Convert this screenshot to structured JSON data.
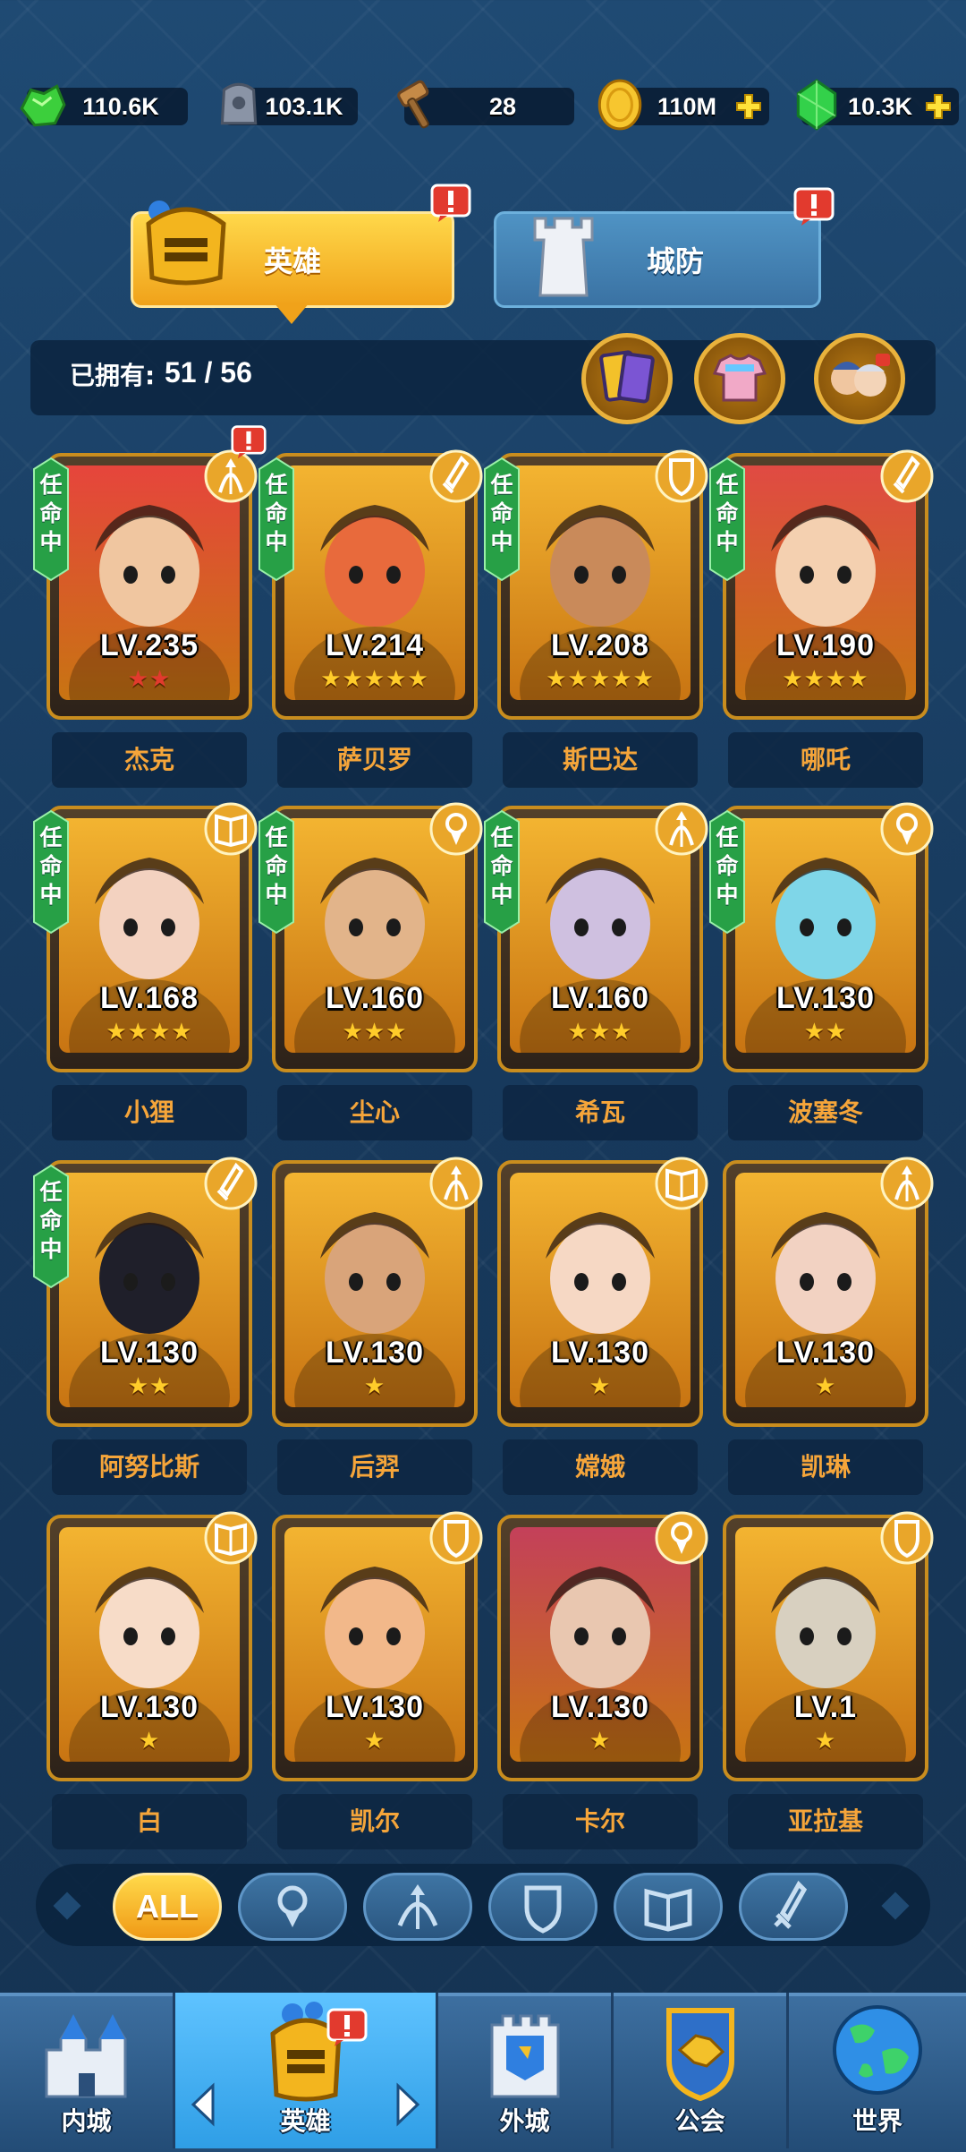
{
  "resources": [
    {
      "name": "energy",
      "value": "110.6K",
      "icon": "green-gem-cluster-icon",
      "has_plus": false
    },
    {
      "name": "stone",
      "value": "103.1K",
      "icon": "stone-tablet-icon",
      "has_plus": false
    },
    {
      "name": "hammer",
      "value": "28",
      "icon": "hammer-icon",
      "has_plus": false
    },
    {
      "name": "gold",
      "value": "110M",
      "icon": "gold-coin-icon",
      "has_plus": true
    },
    {
      "name": "gems",
      "value": "10.3K",
      "icon": "green-gem-icon",
      "has_plus": true
    }
  ],
  "tabs": {
    "heroes": "英雄",
    "defense": "城防",
    "active": "heroes"
  },
  "owned": {
    "label": "已拥有:",
    "count": "51 / 56"
  },
  "heroes": [
    {
      "name": "杰克",
      "level": "LV.235",
      "stars": 2,
      "star_color": "red",
      "class": "archer",
      "appointed": true,
      "alert": true
    },
    {
      "name": "萨贝罗",
      "level": "LV.214",
      "stars": 5,
      "star_color": "gold",
      "class": "warrior",
      "appointed": true,
      "alert": false
    },
    {
      "name": "斯巴达",
      "level": "LV.208",
      "stars": 5,
      "star_color": "gold",
      "class": "tank",
      "appointed": true,
      "alert": false
    },
    {
      "name": "哪吒",
      "level": "LV.190",
      "stars": 4,
      "star_color": "gold",
      "class": "warrior",
      "appointed": true,
      "alert": false
    },
    {
      "name": "小狸",
      "level": "LV.168",
      "stars": 4,
      "star_color": "gold",
      "class": "mage",
      "appointed": true,
      "alert": false
    },
    {
      "name": "尘心",
      "level": "LV.160",
      "stars": 3,
      "star_color": "gold",
      "class": "support",
      "appointed": true,
      "alert": false
    },
    {
      "name": "希瓦",
      "level": "LV.160",
      "stars": 3,
      "star_color": "gold",
      "class": "archer",
      "appointed": true,
      "alert": false
    },
    {
      "name": "波塞冬",
      "level": "LV.130",
      "stars": 2,
      "star_color": "gold",
      "class": "support",
      "appointed": true,
      "alert": false
    },
    {
      "name": "阿努比斯",
      "level": "LV.130",
      "stars": 2,
      "star_color": "gold",
      "class": "warrior",
      "appointed": true,
      "alert": false
    },
    {
      "name": "后羿",
      "level": "LV.130",
      "stars": 1,
      "star_color": "gold",
      "class": "archer",
      "appointed": false,
      "alert": false
    },
    {
      "name": "嫦娥",
      "level": "LV.130",
      "stars": 1,
      "star_color": "gold",
      "class": "mage",
      "appointed": false,
      "alert": false
    },
    {
      "name": "凯琳",
      "level": "LV.130",
      "stars": 1,
      "star_color": "gold",
      "class": "archer",
      "appointed": false,
      "alert": false
    },
    {
      "name": "白",
      "level": "LV.130",
      "stars": 1,
      "star_color": "gold",
      "class": "mage",
      "appointed": false,
      "alert": false
    },
    {
      "name": "凯尔",
      "level": "LV.130",
      "stars": 1,
      "star_color": "gold",
      "class": "tank",
      "appointed": false,
      "alert": false
    },
    {
      "name": "卡尔",
      "level": "LV.130",
      "stars": 1,
      "star_color": "gold",
      "class": "support",
      "appointed": false,
      "alert": false
    },
    {
      "name": "亚拉基",
      "level": "LV.1",
      "stars": 1,
      "star_color": "gold",
      "class": "tank",
      "appointed": false,
      "alert": false
    }
  ],
  "appoint_label": "任命中",
  "filters": [
    {
      "label": "ALL",
      "icon": "",
      "active": true
    },
    {
      "label": "",
      "icon": "support-class-icon",
      "active": false
    },
    {
      "label": "",
      "icon": "archer-class-icon",
      "active": false
    },
    {
      "label": "",
      "icon": "tank-class-icon",
      "active": false
    },
    {
      "label": "",
      "icon": "mage-class-icon",
      "active": false
    },
    {
      "label": "",
      "icon": "warrior-class-icon",
      "active": false
    }
  ],
  "nav": [
    {
      "label": "内城",
      "icon": "inner-castle-icon",
      "active": false
    },
    {
      "label": "英雄",
      "icon": "hero-helmet-icon",
      "active": true,
      "alert": true
    },
    {
      "label": "外城",
      "icon": "outer-castle-icon",
      "active": false
    },
    {
      "label": "公会",
      "icon": "guild-handshake-icon",
      "active": false
    },
    {
      "label": "世界",
      "icon": "world-globe-icon",
      "active": false
    }
  ],
  "colors": {
    "accent_gold": "#f0a21a",
    "accent_blue": "#2f9ee6",
    "name_orange": "#f5a53a",
    "appoint_green": "#27a046",
    "alert_red": "#e23a2e"
  }
}
